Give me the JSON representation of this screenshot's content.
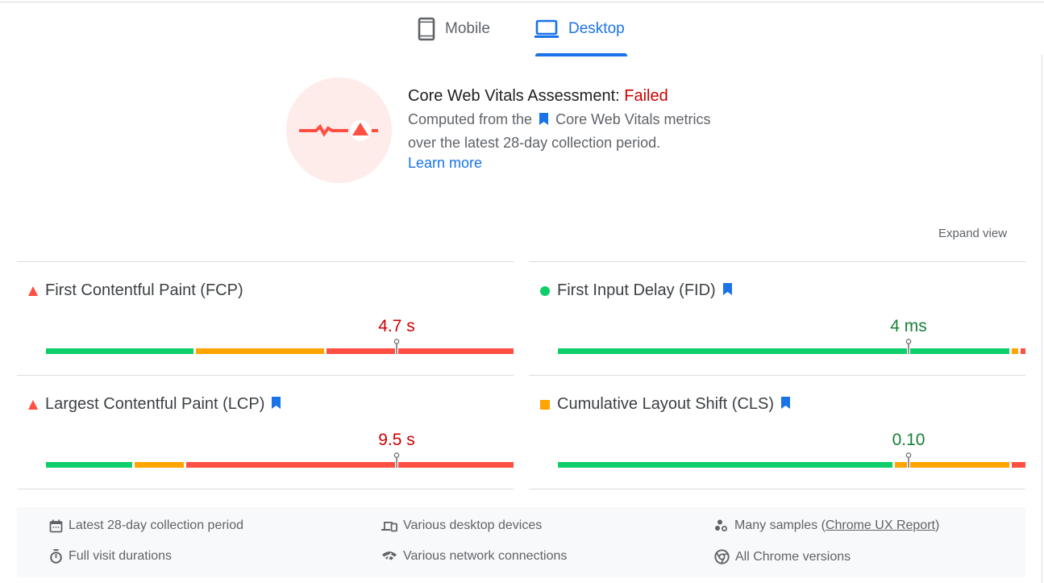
{
  "tabs": [
    {
      "label": "Mobile",
      "icon": "smartphone-icon",
      "active": false
    },
    {
      "label": "Desktop",
      "icon": "laptop-icon",
      "active": true
    }
  ],
  "assessment": {
    "title": "Core Web Vitals Assessment: ",
    "status": "Failed",
    "desc_prefix": "Computed from the",
    "desc_link": "Core Web Vitals metrics",
    "desc_suffix": "over the latest 28-day collection period.",
    "learn_more": "Learn more",
    "colors": {
      "failed": "#cc0000",
      "icon": "#ff4e42",
      "circle_bg": "#fdecea"
    }
  },
  "expand_view": "Expand view",
  "metrics": [
    {
      "name": "First Contentful Paint (FCP)",
      "rating": "poor",
      "indicator": "triangle",
      "core_vital": false,
      "value": "4.7 s",
      "distribution": {
        "good": 0.32,
        "needs_improvement": 0.28,
        "poor": 0.4
      },
      "marker_fraction": 0.75
    },
    {
      "name": "First Input Delay (FID)",
      "rating": "good",
      "indicator": "circle",
      "core_vital": true,
      "value": "4 ms",
      "distribution": {
        "good": 0.97,
        "needs_improvement": 0.02,
        "poor": 0.01
      },
      "marker_fraction": 0.75
    },
    {
      "name": "Largest Contentful Paint (LCP)",
      "rating": "poor",
      "indicator": "triangle",
      "core_vital": true,
      "value": "9.5 s",
      "distribution": {
        "good": 0.19,
        "needs_improvement": 0.11,
        "poor": 0.7
      },
      "marker_fraction": 0.75
    },
    {
      "name": "Cumulative Layout Shift (CLS)",
      "rating": "needs_improvement",
      "indicator": "square",
      "core_vital": true,
      "value": "0.10",
      "distribution": {
        "good": 0.72,
        "needs_improvement": 0.25,
        "poor": 0.03
      },
      "marker_fraction": 0.75
    }
  ],
  "colors": {
    "good": "#0cce6b",
    "needs_improvement": "#ffa400",
    "poor": "#ff4e42",
    "accent": "#1a73e8",
    "bookmark": "#1a73e8"
  },
  "footer": {
    "items": [
      {
        "icon": "calendar-icon",
        "label": "Latest 28-day collection period"
      },
      {
        "icon": "devices-icon",
        "label": "Various desktop devices"
      },
      {
        "icon": "samples-icon",
        "label_prefix": "Many samples (",
        "link": "Chrome UX Report",
        "label_suffix": ")"
      },
      {
        "icon": "timer-icon",
        "label": "Full visit durations"
      },
      {
        "icon": "network-icon",
        "label": "Various network connections"
      },
      {
        "icon": "chrome-icon",
        "label": "All Chrome versions"
      }
    ]
  }
}
